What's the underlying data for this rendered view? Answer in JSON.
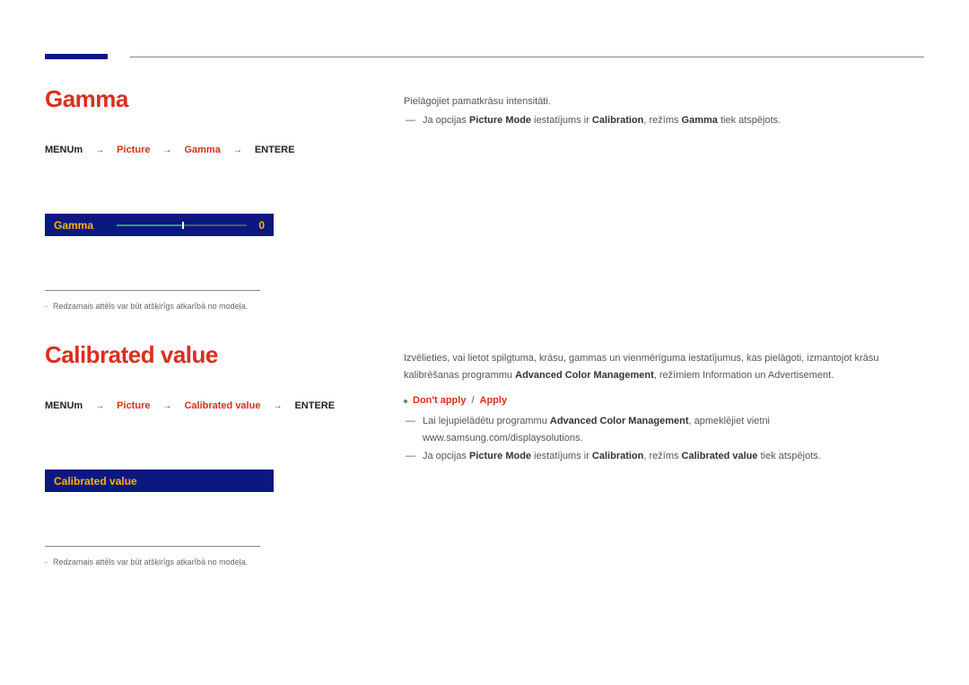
{
  "gamma": {
    "title": "Gamma",
    "bc_menu": "MENUm",
    "bc_picture": "Picture",
    "bc_gamma": "Gamma",
    "bc_enter": "ENTERE",
    "sep": "→",
    "slider_label": "Gamma",
    "slider_value": "0",
    "footnote": "Redzamais attēls var būt atšķirīgs atkarībā no modeļa."
  },
  "calib": {
    "title": "Calibrated value",
    "bc_menu": "MENUm",
    "bc_picture": "Picture",
    "bc_item": "Calibrated value",
    "bc_enter": "ENTERE",
    "sep": "→",
    "label": "Calibrated value",
    "footnote": "Redzamais attēls var būt atšķirīgs atkarībā no modeļa."
  },
  "right_gamma": {
    "intro": "Pielāgojiet pamatkrāsu intensitāti.",
    "note_prefix": "Ja opcijas ",
    "pm": "Picture Mode",
    "note_mid": " iestatījums ir ",
    "calibration": "Calibration",
    "note_mid2": ", režīms ",
    "gamma_ref": "Gamma",
    "note_suffix": " tiek atspējots."
  },
  "right_calib": {
    "p1a": "Izvēlieties, vai lietot spilgtuma, krāsu, gammas un vienmērīguma iestatījumus, kas pielāgoti, izmantojot krāsu kalibrēšanas programmu ",
    "acm": "Advanced Color Management",
    "p1b": ", režīmiem Information un Advertisement.",
    "opt_prefix": "•  ",
    "opt1": "Don't apply",
    "opt_sep": " / ",
    "opt2": "Apply",
    "b1a": "Lai lejupielādētu programmu ",
    "b1b": ", apmeklējiet vietni www.samsung.com/displaysolutions.",
    "b2_prefix": "Ja opcijas ",
    "pm": "Picture Mode",
    "b2_mid": " iestatījums ir ",
    "calibration": "Calibration",
    "b2_mid2": ", režīms ",
    "cv": "Calibrated value",
    "b2_suffix": " tiek atspējots."
  }
}
